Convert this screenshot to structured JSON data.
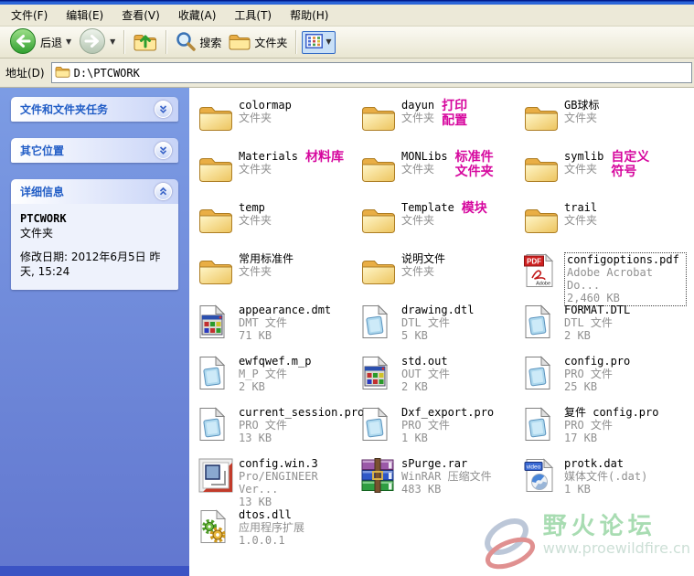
{
  "chrome": {
    "menu_items": [
      "文件(F)",
      "编辑(E)",
      "查看(V)",
      "收藏(A)",
      "工具(T)",
      "帮助(H)"
    ],
    "toolbar": {
      "back_label": "后退",
      "search_label": "搜索",
      "folders_label": "文件夹"
    },
    "address": {
      "label": "地址(D)",
      "value": "D:\\PTCWORK"
    }
  },
  "sidebar": {
    "panels": [
      {
        "title": "文件和文件夹任务",
        "state": "collapsed"
      },
      {
        "title": "其它位置",
        "state": "collapsed"
      },
      {
        "title": "详细信息",
        "state": "expanded"
      }
    ],
    "details": {
      "name": "PTCWORK",
      "type": "文件夹",
      "modified": "修改日期: 2012年6月5日 昨天, 15:24"
    }
  },
  "files": {
    "items": [
      {
        "name": "colormap",
        "type": "文件夹",
        "icon": "folder"
      },
      {
        "name": "dayun",
        "type": "文件夹",
        "icon": "folder",
        "annotation": [
          "打印",
          "配置"
        ]
      },
      {
        "name": "GB球标",
        "type": "文件夹",
        "icon": "folder"
      },
      {
        "name": "Materials",
        "type": "文件夹",
        "icon": "folder",
        "annotation": [
          "材料库"
        ]
      },
      {
        "name": "MONLibs",
        "type": "文件夹",
        "icon": "folder",
        "annotation": [
          "标准件",
          "文件夹"
        ]
      },
      {
        "name": "symlib",
        "type": "文件夹",
        "icon": "folder",
        "annotation": [
          "自定义",
          "符号"
        ]
      },
      {
        "name": "temp",
        "type": "文件夹",
        "icon": "folder"
      },
      {
        "name": "Template",
        "type": "文件夹",
        "icon": "folder",
        "annotation": [
          "模块"
        ]
      },
      {
        "name": "trail",
        "type": "文件夹",
        "icon": "folder"
      },
      {
        "name": "常用标准件",
        "type": "文件夹",
        "icon": "folder"
      },
      {
        "name": "说明文件",
        "type": "文件夹",
        "icon": "folder"
      },
      {
        "name": "configoptions.pdf",
        "type": "Adobe Acrobat Do...",
        "size": "2,460 KB",
        "icon": "pdf",
        "selected": true
      },
      {
        "name": "appearance.dmt",
        "type": "DMT 文件",
        "size": "71 KB",
        "icon": "gridfile"
      },
      {
        "name": "drawing.dtl",
        "type": "DTL 文件",
        "size": "5 KB",
        "icon": "doc"
      },
      {
        "name": "FORMAT.DTL",
        "type": "DTL 文件",
        "size": "2 KB",
        "icon": "doc"
      },
      {
        "name": "ewfqwef.m_p",
        "type": "M_P 文件",
        "size": "2 KB",
        "icon": "doc"
      },
      {
        "name": "std.out",
        "type": "OUT 文件",
        "size": "2 KB",
        "icon": "gridfile"
      },
      {
        "name": "config.pro",
        "type": "PRO 文件",
        "size": "25 KB",
        "icon": "doc"
      },
      {
        "name": "current_session.pro",
        "type": "PRO 文件",
        "size": "13 KB",
        "icon": "doc"
      },
      {
        "name": "Dxf_export.pro",
        "type": "PRO 文件",
        "size": "1 KB",
        "icon": "doc"
      },
      {
        "name": "复件 config.pro",
        "type": "PRO 文件",
        "size": "17 KB",
        "icon": "doc"
      },
      {
        "name": "config.win.3",
        "type": "Pro/ENGINEER Ver...",
        "size": "13 KB",
        "icon": "proe"
      },
      {
        "name": "sPurge.rar",
        "type": "WinRAR 压缩文件",
        "size": "483 KB",
        "icon": "rar"
      },
      {
        "name": "protk.dat",
        "type": "媒体文件(.dat)",
        "size": "1 KB",
        "icon": "media"
      },
      {
        "name": "dtos.dll",
        "type": "应用程序扩展",
        "size": "1.0.0.1",
        "icon": "dll"
      }
    ]
  },
  "watermark": {
    "name": "野火论坛",
    "url": "www.proewildfire.cn"
  },
  "colors": {
    "annotation_magenta": "#d6079e",
    "sidebar_top": "#7c9ce4",
    "sidebar_bottom": "#6277cf",
    "panel_title_blue": "#215dc6",
    "watermark_green": "#a8dcb2",
    "watermark_url_gray": "#ccdfd6"
  }
}
